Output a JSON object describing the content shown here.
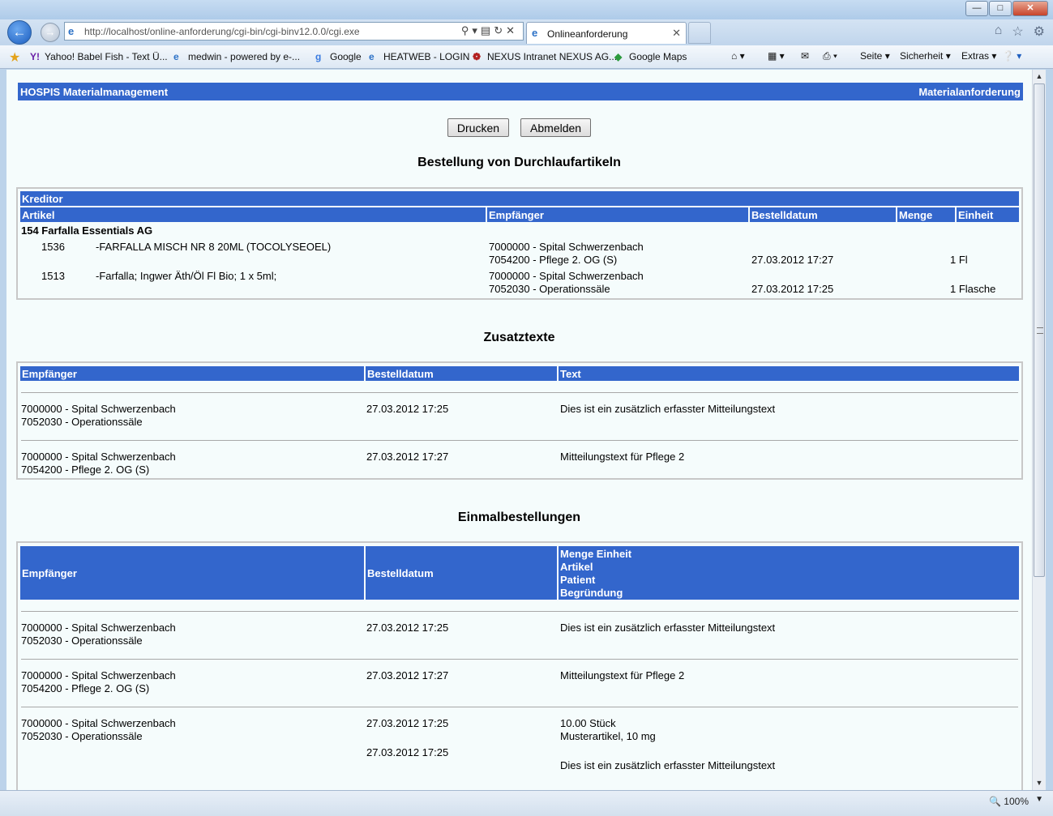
{
  "browser": {
    "window_title": "",
    "address_url": "http://localhost/online-anforderung/cgi-bin/cgi-binv12.0.0/cgi.exe",
    "tab_title": "Onlineanforderung",
    "favorites": [
      "Yahoo! Babel Fish - Text Ü...",
      "medwin - powered by e-...",
      "Google",
      "HEATWEB - LOGIN",
      "NEXUS Intranet NEXUS AG...",
      "Google Maps"
    ],
    "commands": {
      "page": "Seite",
      "safety": "Sicherheit",
      "tools": "Extras"
    },
    "zoom": "100%"
  },
  "header": {
    "left": "HOSPIS Materialmanagement",
    "right": "Materialanforderung"
  },
  "buttons": {
    "print": "Drucken",
    "logout": "Abmelden"
  },
  "durchlauf": {
    "title": "Bestellung von Durchlaufartikeln",
    "kreditor_header": "Kreditor",
    "columns": {
      "artikel": "Artikel",
      "empfaenger": "Empfänger",
      "bestelldatum": "Bestelldatum",
      "menge": "Menge",
      "einheit": "Einheit"
    },
    "kreditor": "154 Farfalla Essentials AG",
    "rows": [
      {
        "nr": "1536",
        "artikel": "-FARFALLA MISCH NR 8 20ML (TOCOLYSEOEL)",
        "empf1": "7000000 - Spital Schwerzenbach",
        "empf2": "7054200 - Pflege 2. OG (S)",
        "datum": "27.03.2012 17:27",
        "menge": "1 Fl"
      },
      {
        "nr": "1513",
        "artikel": "-Farfalla; Ingwer Äth/Öl Fl Bio; 1 x 5ml;",
        "empf1": "7000000 - Spital Schwerzenbach",
        "empf2": "7052030 - Operationssäle",
        "datum": "27.03.2012 17:25",
        "menge": "1 Flasche"
      }
    ]
  },
  "zusatz": {
    "title": "Zusatztexte",
    "columns": {
      "empfaenger": "Empfänger",
      "bestelldatum": "Bestelldatum",
      "text": "Text"
    },
    "rows": [
      {
        "empf1": "7000000 - Spital Schwerzenbach",
        "empf2": "7052030 - Operationssäle",
        "datum": "27.03.2012 17:25",
        "text": "Dies ist ein zusätzlich erfasster Mitteilungstext"
      },
      {
        "empf1": "7000000 - Spital Schwerzenbach",
        "empf2": "7054200 - Pflege 2. OG (S)",
        "datum": "27.03.2012 17:27",
        "text": "Mitteilungstext für Pflege 2"
      }
    ]
  },
  "einmal": {
    "title": "Einmalbestellungen",
    "columns": {
      "empfaenger": "Empfänger",
      "bestelldatum": "Bestelldatum",
      "menge_einheit": "Menge Einheit",
      "artikel": "Artikel",
      "patient": "Patient",
      "begruendung": "Begründung"
    },
    "rows": [
      {
        "empf1": "7000000 - Spital Schwerzenbach",
        "empf2": "7052030 - Operationssäle",
        "datum": "27.03.2012 17:25",
        "text": "Dies ist ein zusätzlich erfasster Mitteilungstext"
      },
      {
        "empf1": "7000000 - Spital Schwerzenbach",
        "empf2": "7054200 - Pflege 2. OG (S)",
        "datum": "27.03.2012 17:27",
        "text": "Mitteilungstext für Pflege 2"
      },
      {
        "empf1": "7000000 - Spital Schwerzenbach",
        "empf2": "7052030 - Operationssäle",
        "datum": "27.03.2012 17:25",
        "datum2": "27.03.2012 17:25",
        "menge": "10.00 Stück",
        "artikel": "Musterartikel, 10 mg",
        "text": "Dies ist ein zusätzlich erfasster Mitteilungstext"
      }
    ]
  }
}
